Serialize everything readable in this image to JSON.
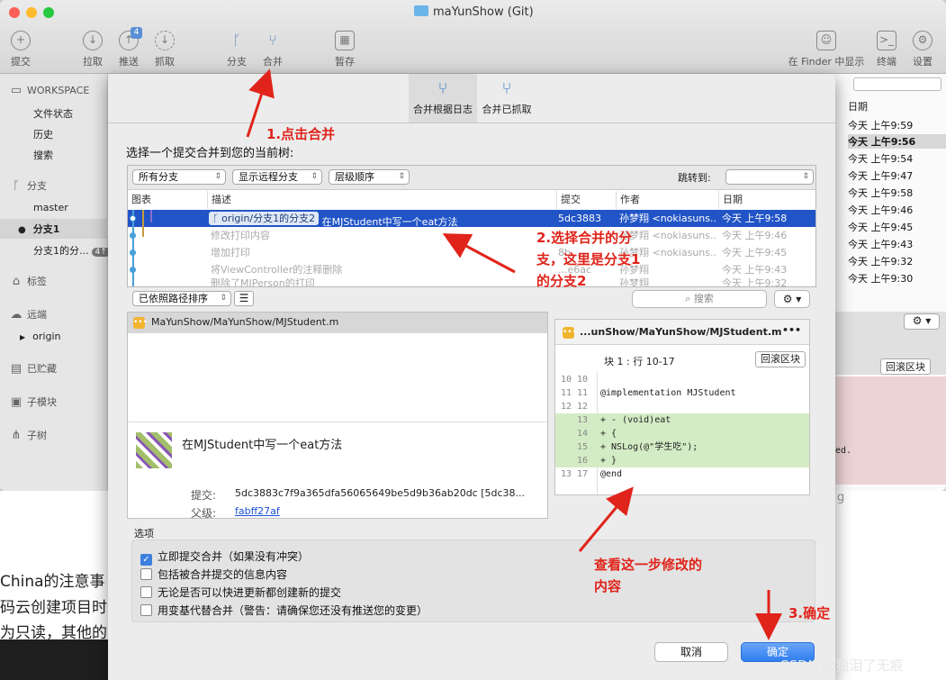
{
  "window": {
    "title": "maYunShow (Git)"
  },
  "toolbar": {
    "commit": "提交",
    "pull": "拉取",
    "push": "推送",
    "fetch": "抓取",
    "branch": "分支",
    "merge": "合并",
    "stash": "暂存",
    "show_in_finder": "在 Finder 中显示",
    "terminal": "终端",
    "settings": "设置",
    "push_badge": "4"
  },
  "sidebar": {
    "workspace": "WORKSPACE",
    "file_status": "文件状态",
    "history": "历史",
    "search": "搜索",
    "branches": "分支",
    "master": "master",
    "branch1": "分支1",
    "branch1_sub": "分支1的分...",
    "branch1_sub_badge": "4↑",
    "tags": "标签",
    "remotes": "远端",
    "origin": "origin",
    "stashes": "已贮藏",
    "submodules": "子模块",
    "subtrees": "子树"
  },
  "right_pane": {
    "date_header": "日期",
    "dates": [
      "今天 上午9:59",
      "今天 上午9:56",
      "今天 上午9:54",
      "今天 上午9:47",
      "今天 上午9:58",
      "今天 上午9:46",
      "今天 上午9:45",
      "今天 上午9:43",
      "今天 上午9:32",
      "今天 上午9:30"
    ],
    "collapse_hunk": "回滚区块",
    "partial_text": "ed."
  },
  "dialog": {
    "tab_merge_log": "合并根据日志",
    "tab_merge_fetched": "合并已抓取",
    "prompt": "选择一个提交合并到您的当前树:",
    "filter_branches": "所有分支",
    "filter_remote": "显示远程分支",
    "filter_order": "层级顺序",
    "jump_to": "跳转到:",
    "columns": {
      "graph": "图表",
      "description": "描述",
      "commit": "提交",
      "author": "作者",
      "date": "日期"
    },
    "commits": [
      {
        "tag": "origin/分支1的分支2",
        "desc": "在MJStudent中写一个eat方法",
        "hash": "5dc3883",
        "author": "孙梦翔 <nokiasuns...",
        "date": "今天 上午9:58"
      },
      {
        "desc": "修改打印内容",
        "hash": "",
        "author": "孙梦翔 <nokiasuns...",
        "date": "今天 上午9:46"
      },
      {
        "desc": "增加打印",
        "hash": "8b...",
        "author": "孙梦翔 <nokiasuns...",
        "date": "今天 上午9:45"
      },
      {
        "desc": "将ViewController的注释删除",
        "hash": "...e6ac",
        "author": "孙梦翔",
        "date": "今天 上午9:43"
      },
      {
        "desc": "删除了MJPerson的打印",
        "hash": "",
        "author": "孙梦翔",
        "date": "今天 上午9:32"
      }
    ],
    "sort": "已依照路径排序",
    "search_placeholder": "搜索",
    "file": "MaYunShow/MaYunShow/MJStudent.m",
    "commit_message": "在MJStudent中写一个eat方法",
    "commit_label": "提交:",
    "commit_full": "5dc3883c7f9a365dfa56065649be5d9b36ab20dc [5dc38...",
    "parent_label": "父级:",
    "parent": "fabff27af",
    "diff": {
      "file": "...unShow/MaYunShow/MJStudent.m",
      "more": "•••",
      "hunk": "块 1 : 行 10-17",
      "collapse": "回滚区块",
      "lines": [
        {
          "n1": "10",
          "n2": "10",
          "text": "",
          "type": "ctx"
        },
        {
          "n1": "11",
          "n2": "11",
          "text": "@implementation MJStudent",
          "type": "ctx"
        },
        {
          "n1": "12",
          "n2": "12",
          "text": "",
          "type": "ctx"
        },
        {
          "n1": "",
          "n2": "13",
          "text": "+ - (void)eat",
          "type": "add"
        },
        {
          "n1": "",
          "n2": "14",
          "text": "+ {",
          "type": "add"
        },
        {
          "n1": "",
          "n2": "15",
          "text": "+     NSLog(@\"学生吃\");",
          "type": "add"
        },
        {
          "n1": "",
          "n2": "16",
          "text": "+ }",
          "type": "add"
        },
        {
          "n1": "13",
          "n2": "17",
          "text": "@end",
          "type": "ctx"
        }
      ]
    },
    "options_title": "选项",
    "options": [
      {
        "label": "立即提交合并（如果没有冲突）",
        "checked": true
      },
      {
        "label": "包括被合并提交的信息内容",
        "checked": false
      },
      {
        "label": "无论是否可以快进更新都创建新的提交",
        "checked": false
      },
      {
        "label": "用变基代替合并（警告：请确保您还没有推送您的变更）",
        "checked": false
      }
    ],
    "cancel": "取消",
    "ok": "确定"
  },
  "background_text": [
    "China的注意事",
    "码云创建项目时",
    "为只读，其他的",
    "g"
  ],
  "annotations": {
    "step1": "1.点击合并",
    "step2_l1": "2.选择合并的分",
    "step2_l2": "支，这里是分支1",
    "step2_l3": "的分支2",
    "view_l1": "查看这一步修改的",
    "view_l2": "内容",
    "step3": "3.确定"
  },
  "watermark": "CSDN @独泪了无痕",
  "colors": {
    "accent": "#2154c6",
    "annotation": "#e0241b",
    "diff_add": "#d4ecc5"
  }
}
